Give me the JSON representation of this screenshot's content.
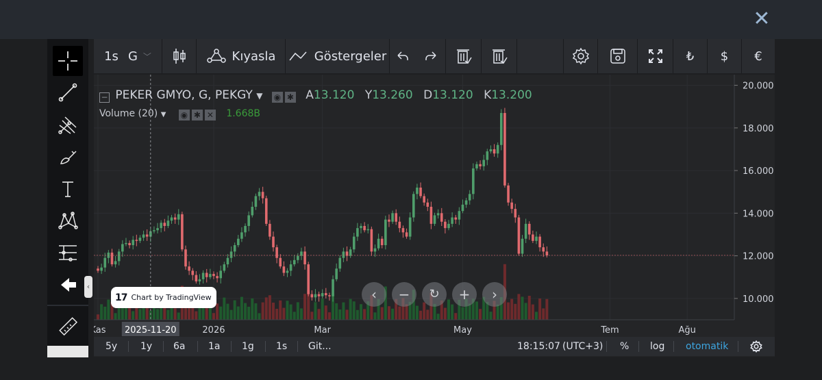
{
  "topbar": {
    "close_glyph": "✕"
  },
  "toolbar": {
    "interval": "1s",
    "resolution": "G",
    "compare_label": "Kıyasla",
    "indicators_label": "Göstergeler",
    "currency_lira": "₺",
    "currency_dollar": "$",
    "currency_euro": "€"
  },
  "legend": {
    "title": "PEKER GMYO, G, PEKGY",
    "open_label": "A",
    "open_value": "13.120",
    "high_label": "Y",
    "high_value": "13.260",
    "low_label": "D",
    "low_value": "13.120",
    "close_label": "K",
    "close_value": "13.200",
    "volume_label": "Volume (20)",
    "volume_value": "1.668B"
  },
  "badge": {
    "text": "Chart by TradingView",
    "logo": "17"
  },
  "bottombar": {
    "ranges": [
      "5y",
      "1y",
      "6a",
      "1a",
      "1g",
      "1s",
      "Git..."
    ],
    "time": "18:15:07",
    "timezone": "(UTC+3)",
    "percent": "%",
    "log": "log",
    "auto": "otomatik"
  },
  "colors": {
    "up": "#4f9e6b",
    "down": "#e06a6e",
    "up_volume": "#1f5a2e",
    "down_volume": "#6e2a2c",
    "accent": "#3da5e0"
  },
  "chart_data": {
    "type": "candlestick",
    "price_axis": {
      "ylim": [
        9.0,
        20.5
      ],
      "ticks": [
        "10.000",
        "12.000",
        "14.000",
        "16.000",
        "18.000",
        "20.000"
      ]
    },
    "last_price": "12.024",
    "crosshair_date": "2025-11-20",
    "x_tick_labels": [
      {
        "label": "Kas",
        "index": 0
      },
      {
        "label": "2026",
        "index": 33
      },
      {
        "label": "Mar",
        "index": 64
      },
      {
        "label": "May",
        "index": 104
      },
      {
        "label": "Tem",
        "index": 146
      },
      {
        "label": "Ağu",
        "index": 168
      }
    ],
    "closes": [
      11.3,
      11.45,
      11.9,
      12.15,
      11.6,
      11.75,
      12.2,
      12.55,
      12.6,
      12.5,
      12.75,
      12.7,
      12.85,
      13.0,
      12.9,
      13.15,
      13.2,
      13.3,
      13.55,
      13.4,
      13.65,
      13.8,
      13.7,
      13.95,
      12.3,
      11.5,
      11.3,
      11.1,
      10.8,
      10.9,
      11.2,
      11.0,
      11.15,
      11.05,
      10.95,
      11.3,
      11.6,
      11.9,
      12.2,
      12.5,
      12.8,
      13.1,
      13.4,
      13.9,
      14.3,
      14.8,
      15.0,
      14.7,
      13.5,
      12.9,
      12.4,
      11.9,
      11.5,
      11.2,
      11.3,
      11.6,
      11.8,
      12.0,
      12.2,
      11.6,
      10.2,
      10.05,
      10.2,
      10.1,
      10.25,
      10.15,
      10.1,
      10.9,
      11.4,
      11.9,
      12.2,
      12.0,
      12.3,
      12.9,
      13.3,
      13.4,
      13.2,
      13.25,
      12.2,
      12.35,
      12.8,
      12.5,
      13.7,
      13.6,
      14.0,
      13.6,
      13.3,
      13.1,
      12.9,
      13.8,
      14.9,
      15.2,
      14.8,
      14.5,
      14.3,
      13.5,
      13.9,
      14.0,
      13.6,
      13.3,
      13.5,
      13.8,
      13.7,
      14.1,
      14.4,
      14.6,
      14.9,
      16.1,
      16.3,
      16.2,
      16.5,
      16.9,
      17.0,
      16.8,
      17.2,
      18.7,
      15.3,
      14.5,
      14.2,
      13.8,
      12.1,
      12.8,
      13.5,
      13.0,
      12.7,
      12.9,
      12.4,
      12.2,
      12.02
    ]
  }
}
